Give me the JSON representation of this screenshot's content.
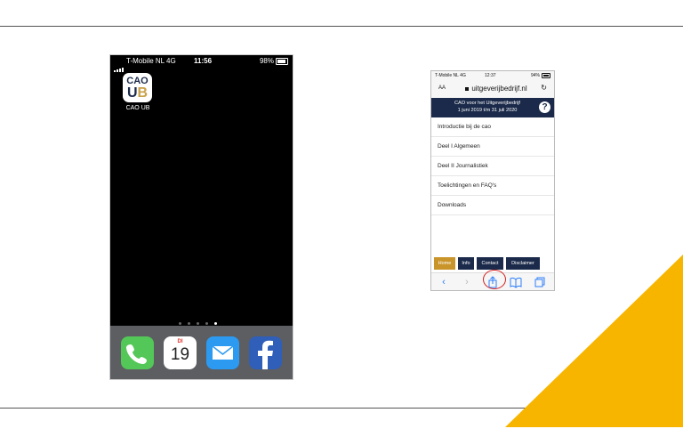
{
  "left_phone": {
    "status": {
      "carrier": "T-Mobile NL  4G",
      "time": "11:56",
      "battery": "98%"
    },
    "app": {
      "icon_line1": "CAO",
      "icon_u": "U",
      "icon_b": "B",
      "label": "CAO UB"
    },
    "page_dots": 5,
    "active_dot": 5,
    "dock": {
      "phone_icon": "phone-icon",
      "calendar": {
        "day": "DI",
        "number": "19"
      },
      "mail_icon": "mail-icon",
      "facebook_icon": "facebook-icon"
    }
  },
  "right_phone": {
    "status": {
      "carrier": "T-Mobile NL  4G",
      "time": "12:37",
      "battery": "94%"
    },
    "url_bar": {
      "aa": "AA",
      "url": "uitgeverijbedrijf.nl",
      "reload_icon": "reload-icon"
    },
    "banner": {
      "line1": "CAO voor het Uitgeverijbedrijf",
      "line2": "1 juni 2019 t/m 31 juli 2020",
      "help": "?"
    },
    "menu_items": [
      "Introductie bij de cao",
      "Deel I Algemeen",
      "Deel II Journalistiek",
      "Toelichtingen en FAQ's",
      "Downloads"
    ],
    "bottom_nav": [
      {
        "label": "Home",
        "color": "#c9952a"
      },
      {
        "label": "Info",
        "color": "#1b2a4a"
      },
      {
        "label": "Contact",
        "color": "#1b2a4a"
      },
      {
        "label": "Disclaimer",
        "color": "#1b2a4a"
      }
    ],
    "toolbar": {
      "back": "‹",
      "forward": "›",
      "share_icon": "share-icon",
      "bookmarks_icon": "bookmarks-icon",
      "tabs_icon": "tabs-icon"
    }
  },
  "colors": {
    "accent_yellow": "#f7b500",
    "navy": "#1b2a4a",
    "highlight_circle": "#d2201f"
  }
}
